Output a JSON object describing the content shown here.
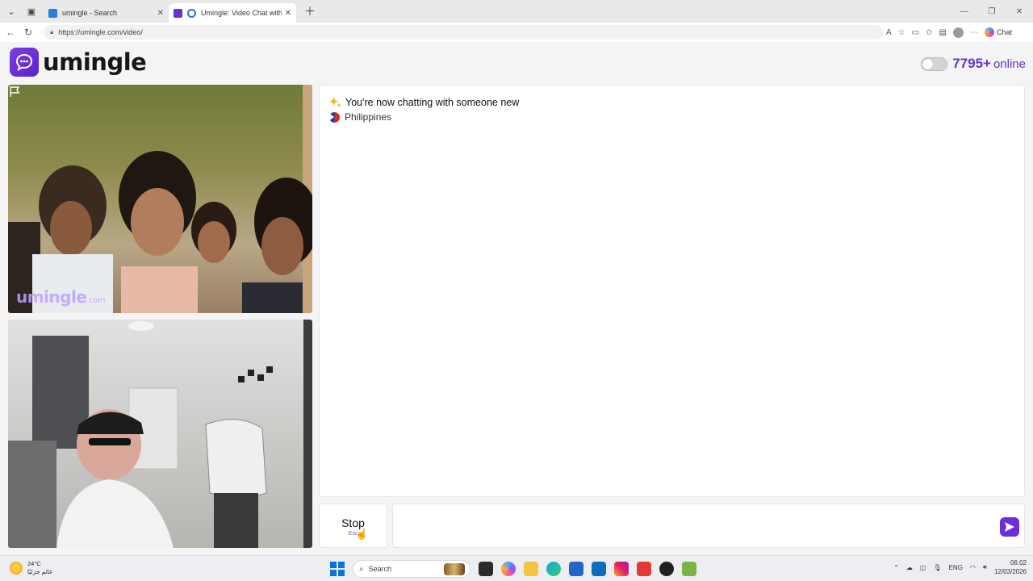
{
  "browser": {
    "tabs": [
      {
        "title": "umingle - Search",
        "active": false
      },
      {
        "title": "Umingle: Video Chat with Stra",
        "active": true
      }
    ],
    "url": "https://umingle.com/video/",
    "chat_label": "Chat"
  },
  "site": {
    "logo_text": "umingle",
    "online_count": "7795+",
    "online_label": "online",
    "brand_color": "#6a2fd6"
  },
  "video": {
    "watermark": "umingle",
    "watermark_suffix": ".com"
  },
  "chat": {
    "status_message": "You're now chatting with someone new",
    "country": "Philippines"
  },
  "controls": {
    "stop_label": "Stop",
    "stop_hint": "Esc",
    "message_placeholder": ""
  },
  "taskbar": {
    "temperature": "24°C",
    "weather_text": "غائم جزئيًا",
    "search_label": "Search",
    "language": "ENG",
    "time": "06:02",
    "date": "12/03/2026"
  }
}
